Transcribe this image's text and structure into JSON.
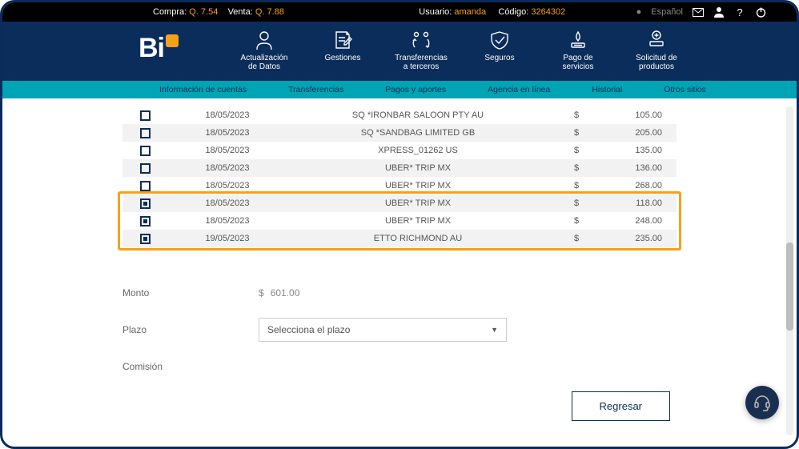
{
  "topbar": {
    "compra_label": "Compra:",
    "compra_value": "Q. 7.54",
    "venta_label": "Venta:",
    "venta_value": "Q. 7.88",
    "usuario_label": "Usuario:",
    "usuario_value": "amanda",
    "codigo_label": "Código:",
    "codigo_value": "3264302",
    "language": "Español"
  },
  "logo_text": "Bi",
  "headnav": [
    "Actualización de Datos",
    "Gestiones",
    "Transferencias a terceros",
    "Seguros",
    "Pago de servicios",
    "Solicitud de productos"
  ],
  "subnav": [
    "Información de cuentas",
    "Transferencias",
    "Pagos y aportes",
    "Agencia en línea",
    "Historial",
    "Otros sitios"
  ],
  "tx": [
    {
      "date": "18/05/2023",
      "desc": "SQ *IRONBAR SALOON PTY AU",
      "cur": "$",
      "amt": "105.00",
      "checked": false
    },
    {
      "date": "18/05/2023",
      "desc": "SQ *SANDBAG LIMITED GB",
      "cur": "$",
      "amt": "205.00",
      "checked": false
    },
    {
      "date": "18/05/2023",
      "desc": "XPRESS_01262 US",
      "cur": "$",
      "amt": "135.00",
      "checked": false
    },
    {
      "date": "18/05/2023",
      "desc": "UBER* TRIP MX",
      "cur": "$",
      "amt": "136.00",
      "checked": false
    },
    {
      "date": "18/05/2023",
      "desc": "UBER* TRIP MX",
      "cur": "$",
      "amt": "268.00",
      "checked": false
    },
    {
      "date": "18/05/2023",
      "desc": "UBER* TRIP MX",
      "cur": "$",
      "amt": "118.00",
      "checked": true
    },
    {
      "date": "18/05/2023",
      "desc": "UBER* TRIP MX",
      "cur": "$",
      "amt": "248.00",
      "checked": true
    },
    {
      "date": "19/05/2023",
      "desc": "ETTO RICHMOND AU",
      "cur": "$",
      "amt": "235.00",
      "checked": true
    }
  ],
  "form": {
    "monto_label": "Monto",
    "monto_currency": "$",
    "monto_value": "601.00",
    "plazo_label": "Plazo",
    "plazo_placeholder": "Selecciona el plazo",
    "comision_label": "Comisión",
    "regresar_label": "Regresar"
  }
}
